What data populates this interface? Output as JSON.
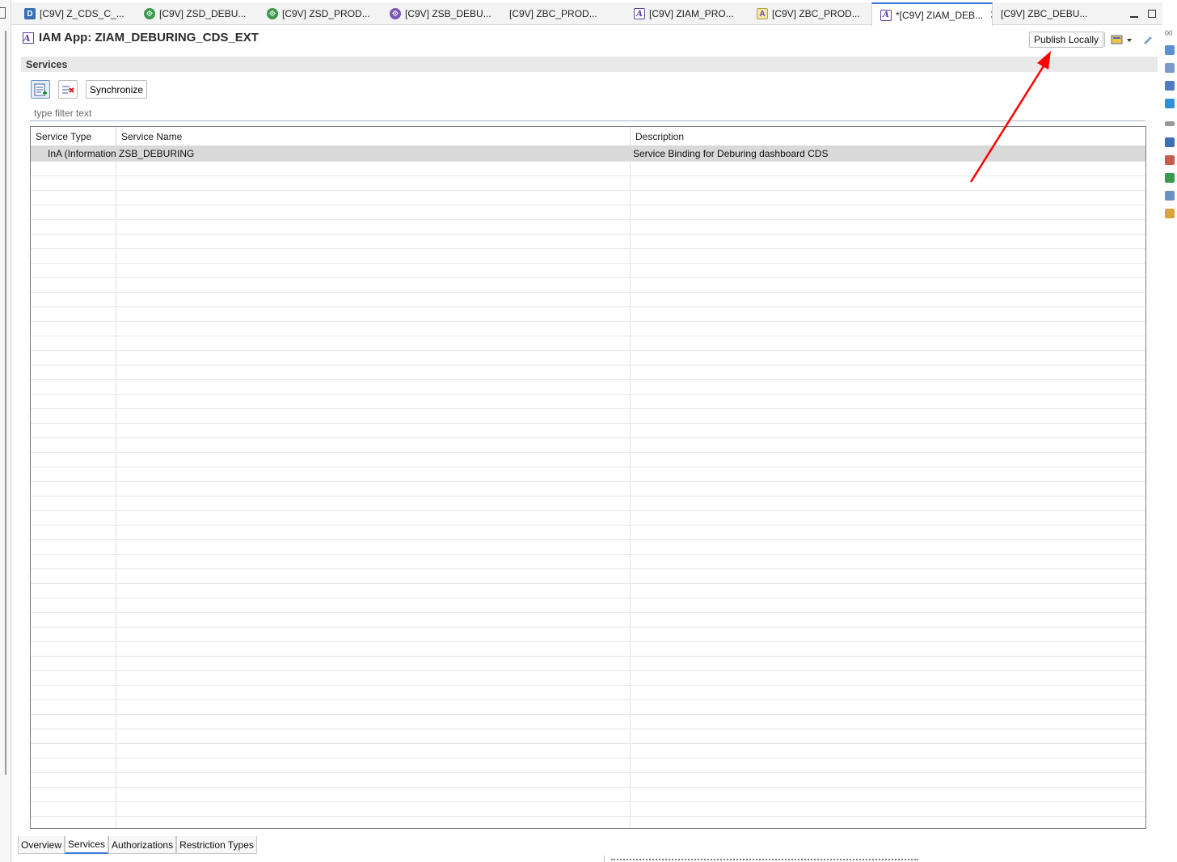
{
  "editor_tabs": [
    {
      "label": "[C9V] Z_CDS_C_...",
      "icon": "ddl-source-icon",
      "glyph": "D"
    },
    {
      "label": "[C9V] ZSD_DEBU...",
      "icon": "service-definition-icon",
      "glyph": "⟐"
    },
    {
      "label": "[C9V] ZSD_PROD...",
      "icon": "service-definition-icon",
      "glyph": "⟐"
    },
    {
      "label": "[C9V] ZSB_DEBU...",
      "icon": "service-binding-icon",
      "glyph": "⟐"
    },
    {
      "label": "[C9V] ZBC_PROD...",
      "icon": "business-catalog-icon",
      "glyph": ""
    },
    {
      "label": "[C9V] ZIAM_PRO...",
      "icon": "iam-app-icon",
      "glyph": "A"
    },
    {
      "label": "[C9V] ZBC_PROD...",
      "icon": "metadata-icon",
      "glyph": "A"
    },
    {
      "label": "*[C9V] ZIAM_DEB...",
      "icon": "iam-app-icon",
      "glyph": "A",
      "active": true
    },
    {
      "label": "[C9V] ZBC_DEBU...",
      "icon": "business-catalog-icon",
      "glyph": ""
    }
  ],
  "editor": {
    "title": "IAM App: ZIAM_DEBURING_CDS_EXT",
    "title_icon_glyph": "A",
    "publish_label": "Publish Locally"
  },
  "services": {
    "section_title": "Services",
    "sync_label": "Synchronize",
    "filter_placeholder": "type filter text",
    "columns": [
      "Service Type",
      "Service Name",
      "Description"
    ],
    "rows": [
      {
        "type": "InA (Information",
        "name": "ZSB_DEBURING",
        "description": "Service Binding for Deburing dashboard CDS"
      }
    ]
  },
  "bottom_tabs": [
    "Overview",
    "Services",
    "Authorizations",
    "Restriction Types"
  ],
  "active_bottom_tab": "Services",
  "colors": {
    "accent": "#3c78d8",
    "selected_row": "#d9d9d9",
    "annotation_arrow": "#ff0000"
  }
}
